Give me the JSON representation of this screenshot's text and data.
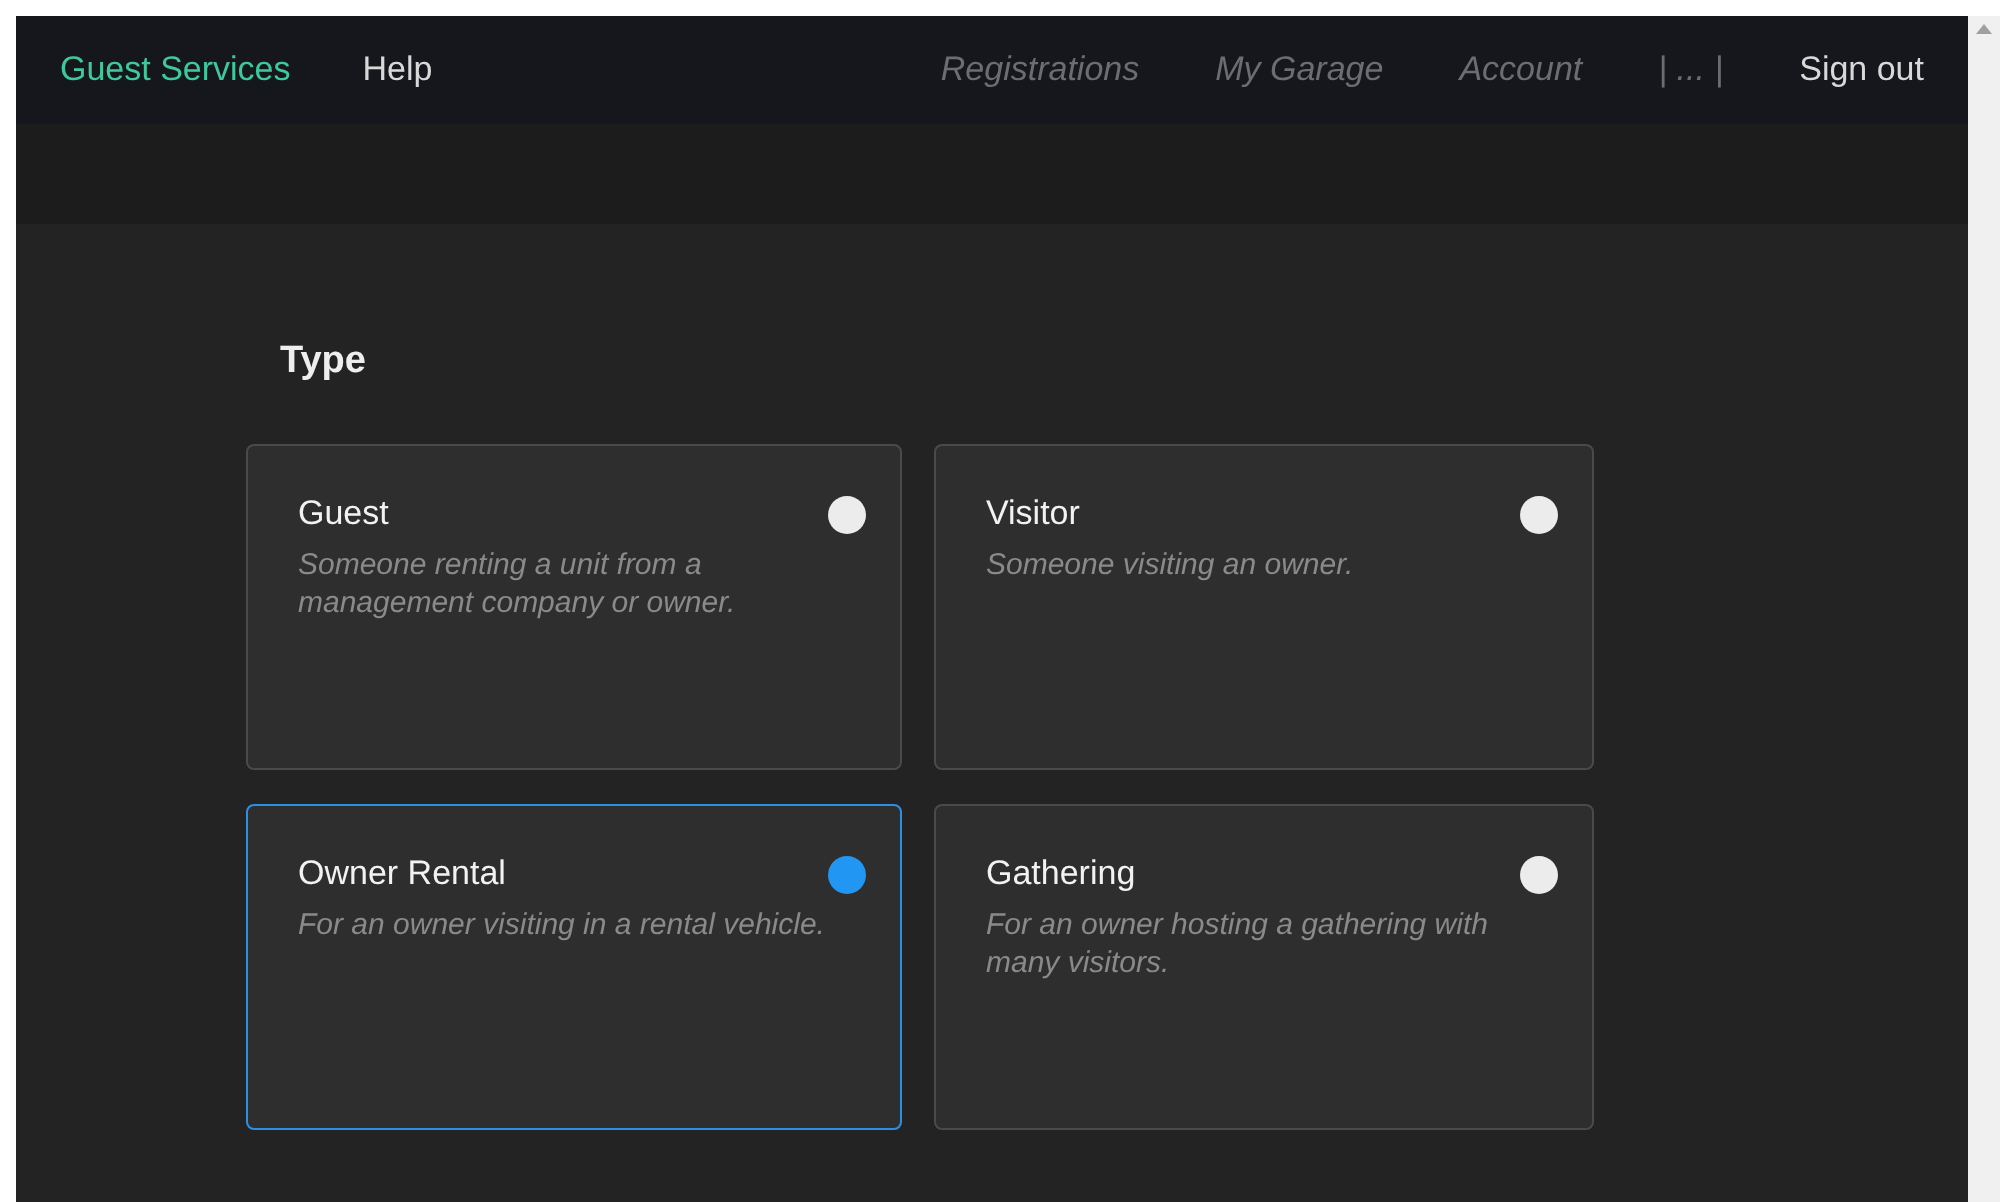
{
  "nav": {
    "brand": "Guest Services",
    "links": [
      {
        "label": "Help",
        "disabled": false
      }
    ],
    "right_links": [
      {
        "label": "Registrations",
        "disabled": true
      },
      {
        "label": "My Garage",
        "disabled": true
      },
      {
        "label": "Account",
        "disabled": true
      },
      {
        "label": "| ... |",
        "disabled": true
      },
      {
        "label": "Sign out",
        "disabled": false
      }
    ]
  },
  "section": {
    "title": "Type",
    "options": [
      {
        "title": "Guest",
        "description": "Someone renting a unit from a management company or owner.",
        "selected": false
      },
      {
        "title": "Visitor",
        "description": "Someone visiting an owner.",
        "selected": false
      },
      {
        "title": "Owner Rental",
        "description": "For an owner visiting in a rental vehicle.",
        "selected": true
      },
      {
        "title": "Gathering",
        "description": "For an owner hosting a gathering with many visitors.",
        "selected": false
      }
    ]
  }
}
